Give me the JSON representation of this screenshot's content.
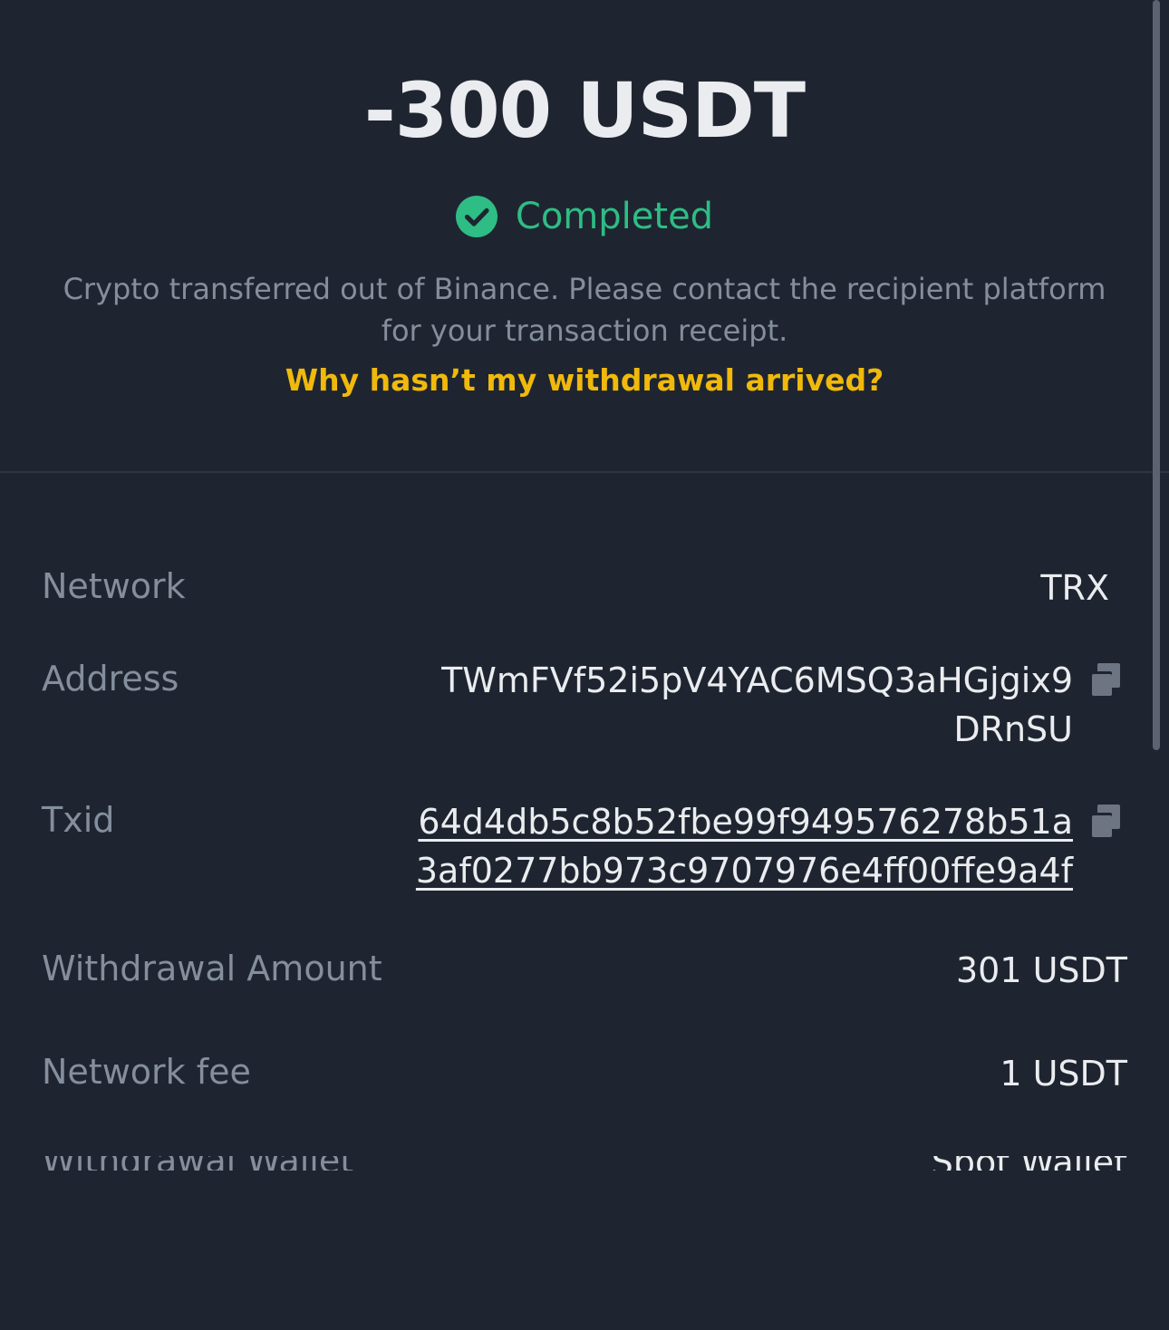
{
  "header": {
    "amount": "-300 USDT",
    "status": "Completed",
    "description": "Crypto transferred out of Binance. Please contact the recipient platform for your transaction receipt.",
    "help_link": "Why hasn’t my withdrawal arrived?"
  },
  "details": {
    "network": {
      "label": "Network",
      "value": "TRX"
    },
    "address": {
      "label": "Address",
      "line1": "TWmFVf52i5pV4YAC6MSQ3aHGjgix9",
      "line2": "DRnSU"
    },
    "txid": {
      "label": "Txid",
      "line1": "64d4db5c8b52fbe99f949576278b51a",
      "line2": "3af0277bb973c9707976e4ff00ffe9a4f"
    },
    "withdrawal_amount": {
      "label": "Withdrawal Amount",
      "value": "301 USDT"
    },
    "network_fee": {
      "label": "Network fee",
      "value": "1 USDT"
    },
    "withdrawal_wallet": {
      "label": "Withdrawal Wallet",
      "value": "Spot Wallet"
    }
  },
  "icons": {
    "status": "check-circle-icon",
    "copy": "copy-icon"
  },
  "colors": {
    "background": "#1f2530",
    "success": "#2ebd85",
    "link": "#f0b90b",
    "muted": "#848e9c",
    "text": "#eaecef"
  }
}
